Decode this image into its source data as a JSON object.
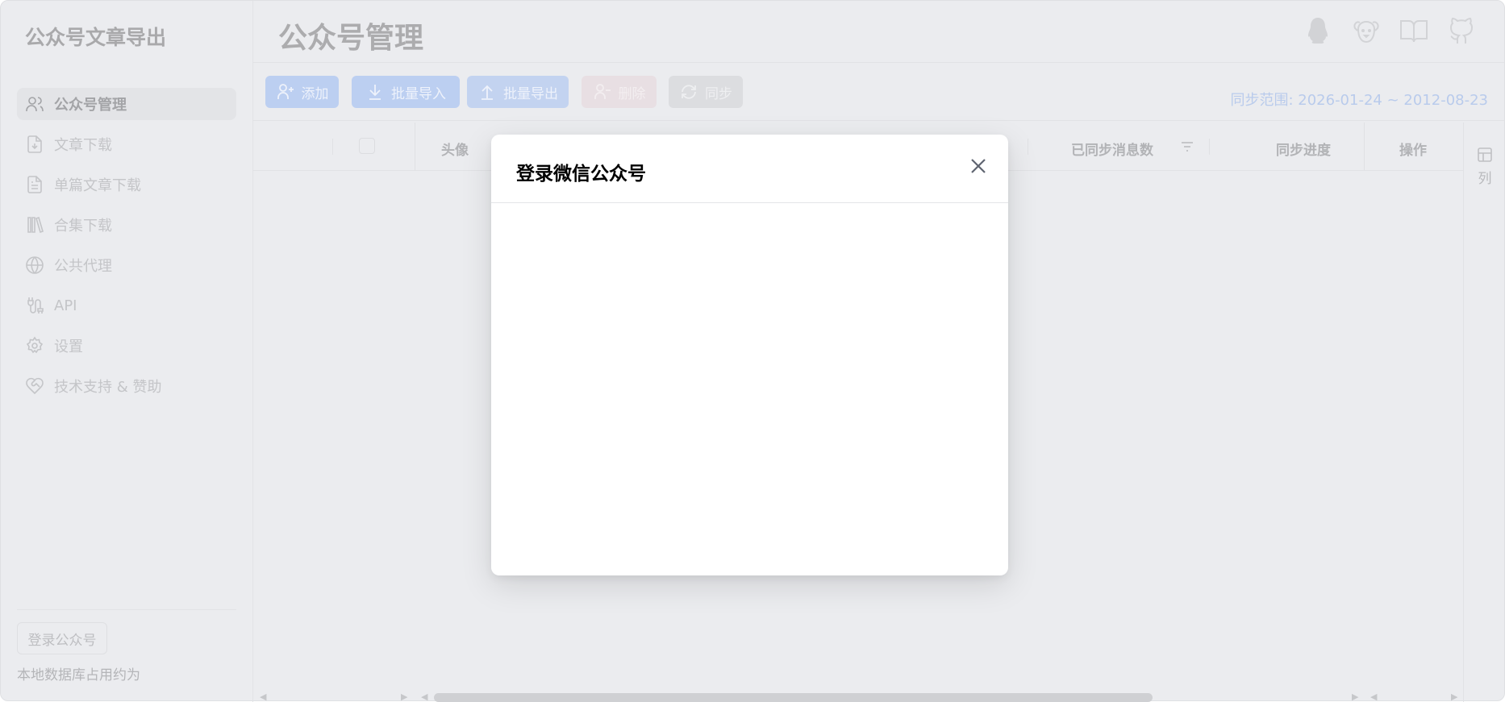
{
  "app": {
    "brand": "公众号文章导出"
  },
  "sidebar": {
    "items": [
      {
        "label": "公众号管理",
        "icon": "users-icon",
        "active": true
      },
      {
        "label": "文章下载",
        "icon": "file-download-icon"
      },
      {
        "label": "单篇文章下载",
        "icon": "file-text-icon"
      },
      {
        "label": "合集下载",
        "icon": "library-icon"
      },
      {
        "label": "公共代理",
        "icon": "globe-icon"
      },
      {
        "label": "API",
        "icon": "api-plug-icon"
      },
      {
        "label": "设置",
        "icon": "gear-icon"
      },
      {
        "label": "技术支持 & 赞助",
        "icon": "heart-handshake-icon"
      }
    ],
    "login_button": "登录公众号",
    "db_note": "本地数据库占用约为"
  },
  "header": {
    "title": "公众号管理",
    "icons": [
      "qq-icon",
      "dog-icon",
      "book-icon",
      "github-icon"
    ]
  },
  "toolbar": {
    "add": "添加",
    "import": "批量导入",
    "export": "批量导出",
    "delete": "删除",
    "sync": "同步",
    "sync_range": "同步范围: 2026-01-24 ~ 2012-08-23"
  },
  "table": {
    "columns": {
      "avatar": "头像",
      "synced_count": "已同步消息数",
      "progress": "同步进度",
      "actions": "操作"
    },
    "column_settings": "列"
  },
  "modal": {
    "title": "登录微信公众号"
  },
  "colors": {
    "primary": "#4f86e8",
    "danger": "#f56c6c",
    "overlay_bg": "#ebecef"
  }
}
